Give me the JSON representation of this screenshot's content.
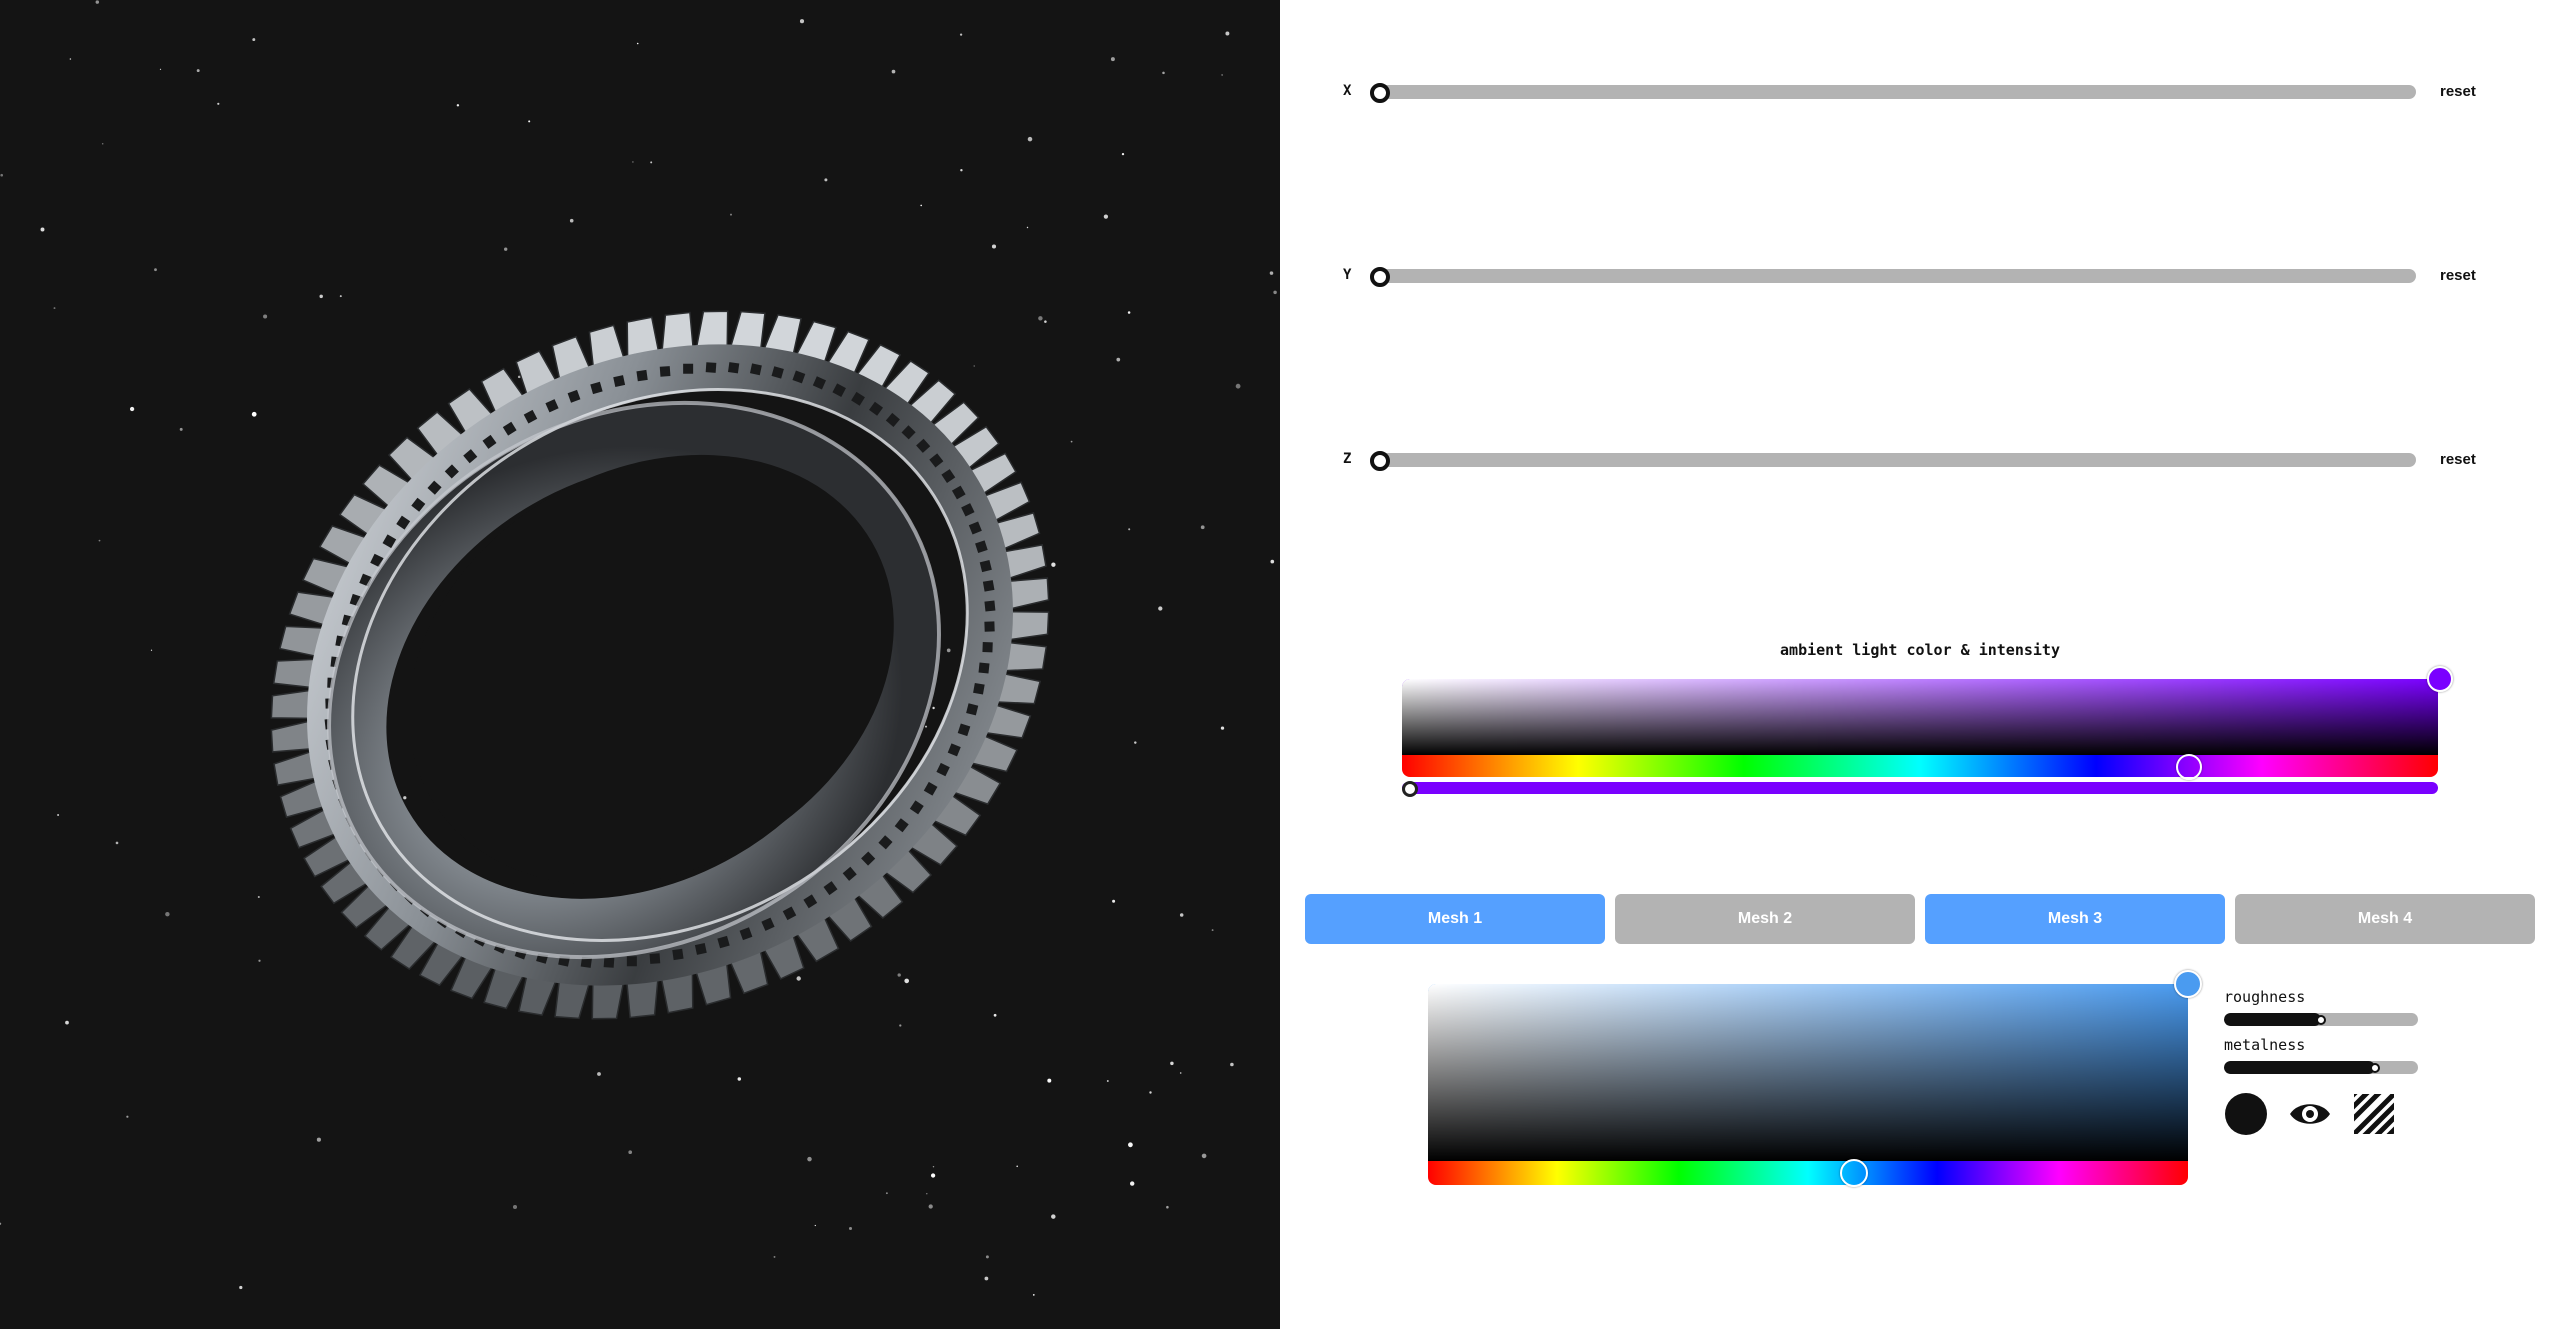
{
  "viewport": {
    "background": "#141414",
    "object": "ring-model"
  },
  "transform": {
    "axes": [
      {
        "label": "X",
        "value": 0,
        "reset_label": "reset"
      },
      {
        "label": "Y",
        "value": 0,
        "reset_label": "reset"
      },
      {
        "label": "Z",
        "value": 0,
        "reset_label": "reset"
      }
    ]
  },
  "ambient": {
    "title": "ambient light color & intensity",
    "color": "#7a00ff",
    "hue_position": 0.76,
    "intensity": 0.0
  },
  "meshes": {
    "tabs": [
      {
        "label": "Mesh 1",
        "active": true
      },
      {
        "label": "Mesh 2",
        "active": false
      },
      {
        "label": "Mesh 3",
        "active": true
      },
      {
        "label": "Mesh 4",
        "active": false
      }
    ],
    "active_color": "#55a0ff",
    "inactive_color": "#b3b3b3"
  },
  "material": {
    "color": "#4a9bf0",
    "hue_position": 0.56,
    "roughness_label": "roughness",
    "roughness": 0.5,
    "metalness_label": "metalness",
    "metalness": 0.78,
    "icons": [
      "solid-circle-icon",
      "eye-icon",
      "hatch-pattern-icon"
    ]
  }
}
